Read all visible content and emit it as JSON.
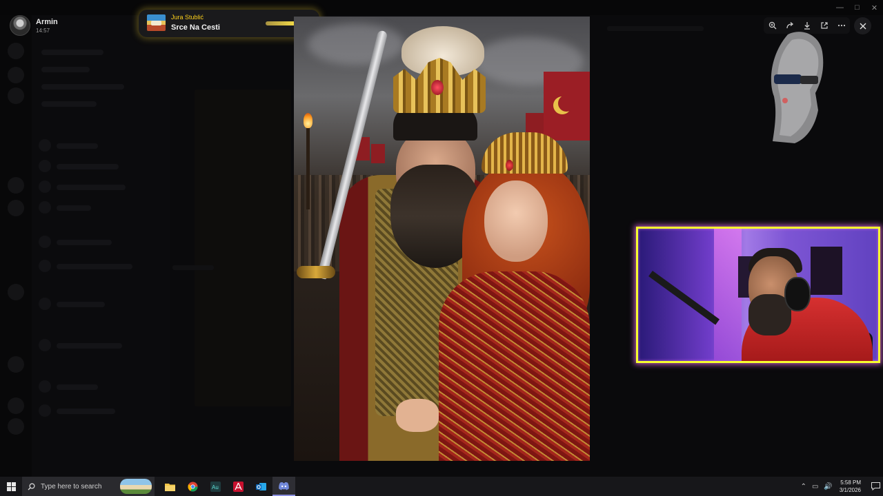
{
  "user": {
    "name": "Armin",
    "time": "14:57"
  },
  "now_playing": {
    "artist": "Jura Stublić",
    "track": "Srce Na Cesti",
    "progress": 0.62
  },
  "viewer": {
    "toolbar": [
      "zoom-in-icon",
      "forward-icon",
      "download-icon",
      "open-external-icon",
      "more-icon"
    ],
    "close_icon": "close-icon"
  },
  "taskbar": {
    "search_placeholder": "Type here to search",
    "apps": [
      "file-explorer-icon",
      "chrome-icon",
      "audition-icon",
      "acrobat-icon",
      "outlook-icon",
      "discord-icon"
    ],
    "active_app": "discord-icon",
    "clock_time": "5:58 PM",
    "clock_date": "3/1/2026"
  },
  "colors": {
    "accent_yellow": "#ffd21c",
    "webcam_border": "#f7ff2e",
    "webcam_glow": "#ff78ff"
  }
}
